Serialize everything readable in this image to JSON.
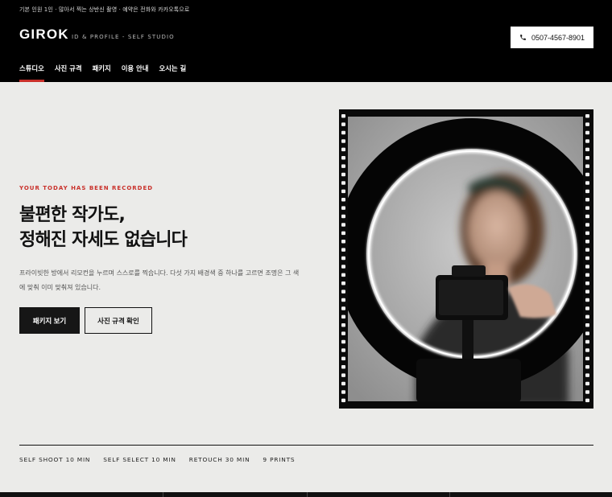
{
  "header": {
    "topline": "기본 인원 1인 · 많아서 찍는 상반신 촬영 · 예약은 전화와 카카오톡으로",
    "logo": "GIROK",
    "tagline": "ID & PROFILE - SELF STUDIO",
    "phone": "0507-4567-8901",
    "phone_icon": "phone-icon"
  },
  "nav": {
    "items": [
      "스튜디오",
      "사진 규격",
      "패키지",
      "이용 안내",
      "오시는 길"
    ],
    "active_index": 0
  },
  "hero": {
    "eyebrow": "YOUR TODAY HAS BEEN RECORDED",
    "title_line1": "불편한 작가도,",
    "title_line2": "정해진 자세도 없습니다",
    "desc": "프라이빗한 방에서 리모컨을 누르며 스스로를 찍습니다. 다섯 가지 배경색 중 하나를 고르면 조명은 그 색에 맞춰 이미 맞춰져 있습니다.",
    "primary_button": "패키지 보기",
    "secondary_button": "사진 규격 확인"
  },
  "stats": [
    "SELF SHOOT 10 MIN",
    "SELF SELECT 10 MIN",
    "RETOUCH 30 MIN",
    "9 PRINTS"
  ],
  "colors": {
    "accent": "#c9302a",
    "header_bg": "#000000",
    "page_bg": "#ebebe9",
    "button_dark": "#161616"
  }
}
